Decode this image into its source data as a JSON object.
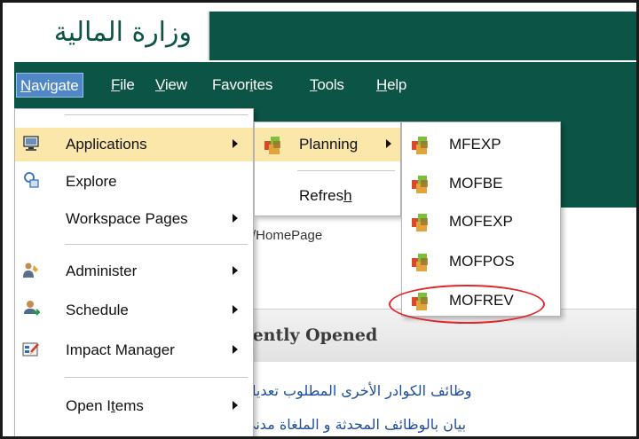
{
  "header": {
    "logo_text": "وزارة المالية"
  },
  "menubar": {
    "items": [
      {
        "label": "Navigate",
        "mn": "N",
        "rest": "avigate"
      },
      {
        "label": "File",
        "mn": "F",
        "rest": "ile"
      },
      {
        "label": "View",
        "mn": "V",
        "rest": "iew"
      },
      {
        "label": "Favorites",
        "pre": "Favor",
        "mn": "i",
        "rest": "tes"
      },
      {
        "label": "Tools",
        "mn": "T",
        "rest": "ools"
      },
      {
        "label": "Help",
        "mn": "H",
        "rest": "elp"
      }
    ]
  },
  "navigate_menu": {
    "items": [
      {
        "label": "Applications",
        "has_submenu": true,
        "highlighted": true,
        "icon": "monitor-icon"
      },
      {
        "label": "Explore",
        "has_submenu": false,
        "icon": "explore-icon"
      },
      {
        "label": "Workspace Pages",
        "has_submenu": true,
        "icon": ""
      },
      {
        "label": "Administer",
        "has_submenu": true,
        "icon": "admin-icon"
      },
      {
        "label": "Schedule",
        "has_submenu": true,
        "icon": "schedule-icon"
      },
      {
        "label": "Impact Manager",
        "has_submenu": true,
        "icon": "impact-manager-icon"
      },
      {
        "label": "Open Items",
        "has_submenu": true,
        "icon": ""
      }
    ]
  },
  "applications_menu": {
    "items": [
      {
        "label": "Planning",
        "has_submenu": true,
        "highlighted": true
      },
      {
        "label": "Refresh",
        "pre": "Refres",
        "mn": "h"
      }
    ]
  },
  "planning_menu": {
    "items": [
      {
        "label": "MFEXP"
      },
      {
        "label": "MOFBE"
      },
      {
        "label": "MOFEXP"
      },
      {
        "label": "MOFPOS"
      },
      {
        "label": "MOFREV",
        "annotated": true
      }
    ]
  },
  "background": {
    "path_text": "/HomePage",
    "recent_heading": "cently Opened",
    "links": [
      "وظائف الكوادر الأخرى المطلوب تعديله",
      "بيان بالوظائف المحدثة و الملغاة مدني"
    ]
  },
  "colors": {
    "header_green": "#0b5446",
    "highlight": "#fbe7a9",
    "active_menu": "#4f87c7",
    "annotation": "#e0262b"
  }
}
